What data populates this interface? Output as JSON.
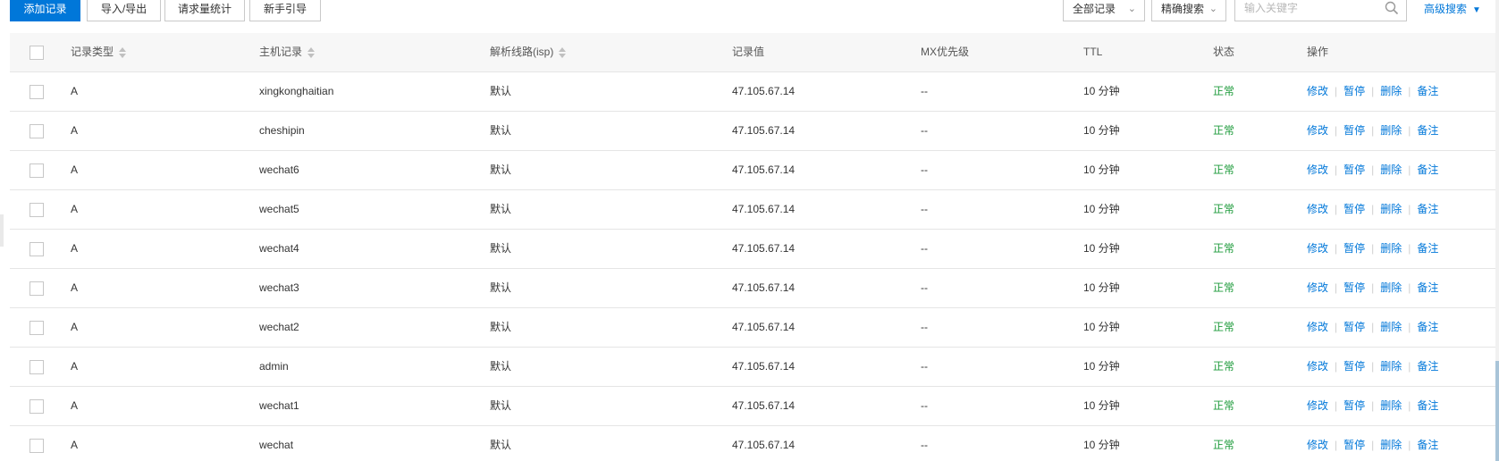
{
  "toolbar": {
    "add_label": "添加记录",
    "import_label": "导入/导出",
    "stats_label": "请求量统计",
    "guide_label": "新手引导",
    "filter_label": "全部记录",
    "search_mode_label": "精确搜索",
    "search_placeholder": "输入关键字",
    "search_value": "",
    "advanced_label": "高级搜索"
  },
  "table": {
    "headers": {
      "type": "记录类型",
      "host": "主机记录",
      "line": "解析线路(isp)",
      "value": "记录值",
      "mx": "MX优先级",
      "ttl": "TTL",
      "status": "状态",
      "ops": "操作"
    },
    "op_labels": [
      "修改",
      "暂停",
      "删除",
      "备注"
    ],
    "rows": [
      {
        "type": "A",
        "host": "xingkonghaitian",
        "line": "默认",
        "value": "47.105.67.14",
        "mx": "--",
        "ttl": "10 分钟",
        "status": "正常"
      },
      {
        "type": "A",
        "host": "cheshipin",
        "line": "默认",
        "value": "47.105.67.14",
        "mx": "--",
        "ttl": "10 分钟",
        "status": "正常"
      },
      {
        "type": "A",
        "host": "wechat6",
        "line": "默认",
        "value": "47.105.67.14",
        "mx": "--",
        "ttl": "10 分钟",
        "status": "正常"
      },
      {
        "type": "A",
        "host": "wechat5",
        "line": "默认",
        "value": "47.105.67.14",
        "mx": "--",
        "ttl": "10 分钟",
        "status": "正常"
      },
      {
        "type": "A",
        "host": "wechat4",
        "line": "默认",
        "value": "47.105.67.14",
        "mx": "--",
        "ttl": "10 分钟",
        "status": "正常"
      },
      {
        "type": "A",
        "host": "wechat3",
        "line": "默认",
        "value": "47.105.67.14",
        "mx": "--",
        "ttl": "10 分钟",
        "status": "正常"
      },
      {
        "type": "A",
        "host": "wechat2",
        "line": "默认",
        "value": "47.105.67.14",
        "mx": "--",
        "ttl": "10 分钟",
        "status": "正常"
      },
      {
        "type": "A",
        "host": "admin",
        "line": "默认",
        "value": "47.105.67.14",
        "mx": "--",
        "ttl": "10 分钟",
        "status": "正常"
      },
      {
        "type": "A",
        "host": "wechat1",
        "line": "默认",
        "value": "47.105.67.14",
        "mx": "--",
        "ttl": "10 分钟",
        "status": "正常"
      },
      {
        "type": "A",
        "host": "wechat",
        "line": "默认",
        "value": "47.105.67.14",
        "mx": "--",
        "ttl": "10 分钟",
        "status": "正常"
      }
    ]
  },
  "colors": {
    "accent": "#0077d9",
    "status_ok": "#1e9b3b",
    "header_bg": "#f7f7f7"
  },
  "icons": {
    "search": "search-icon",
    "dropdown": "chevron-down-icon",
    "advanced": "caret-down-icon"
  }
}
